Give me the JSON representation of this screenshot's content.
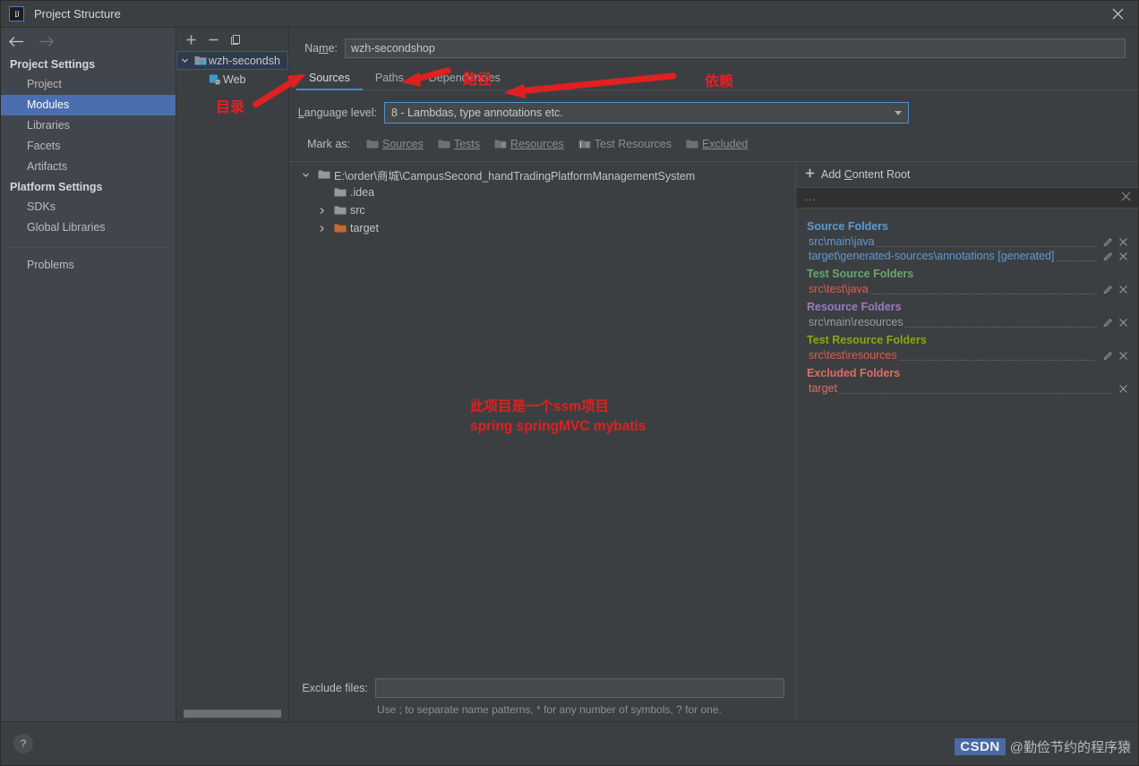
{
  "window": {
    "title": "Project Structure",
    "logo_text": "IJ",
    "close_icon": "close-icon"
  },
  "sidebar": {
    "back_icon": "arrow-left-icon",
    "forward_icon": "arrow-right-icon",
    "groups": [
      {
        "title": "Project Settings",
        "items": [
          {
            "label": "Project",
            "selected": false
          },
          {
            "label": "Modules",
            "selected": true
          },
          {
            "label": "Libraries",
            "selected": false
          },
          {
            "label": "Facets",
            "selected": false
          },
          {
            "label": "Artifacts",
            "selected": false
          }
        ]
      },
      {
        "title": "Platform Settings",
        "items": [
          {
            "label": "SDKs",
            "selected": false
          },
          {
            "label": "Global Libraries",
            "selected": false
          }
        ]
      }
    ],
    "problems_label": "Problems"
  },
  "modules_panel": {
    "toolbar": {
      "add_icon": "plus-icon",
      "remove_icon": "minus-icon",
      "copy_icon": "copy-icon"
    },
    "tree": [
      {
        "label": "wzh-secondsh",
        "icon": "module-icon",
        "expanded": true,
        "selected": true,
        "depth": 0
      },
      {
        "label": "Web",
        "icon": "web-facet-icon",
        "expanded": false,
        "selected": false,
        "depth": 1
      }
    ]
  },
  "module_editor": {
    "name_label": "Name:",
    "name_value": "wzh-secondshop",
    "tabs": [
      {
        "label": "Sources",
        "active": true
      },
      {
        "label": "Paths",
        "active": false
      },
      {
        "label": "Dependencies",
        "active": false
      }
    ],
    "language_level_label": "Language level:",
    "language_level_value": "8 - Lambdas, type annotations etc.",
    "mark_as_label": "Mark as:",
    "mark_as_buttons": [
      {
        "label": "Sources",
        "icon": "folder-sources-icon"
      },
      {
        "label": "Tests",
        "icon": "folder-tests-icon"
      },
      {
        "label": "Resources",
        "icon": "folder-resources-icon"
      },
      {
        "label": "Test Resources",
        "icon": "folder-test-resources-icon"
      },
      {
        "label": "Excluded",
        "icon": "folder-excluded-icon"
      }
    ],
    "content_tree": [
      {
        "label": "E:\\order\\商城\\CampusSecond_handTradingPlatformManagementSystem",
        "icon": "folder-icon",
        "twisty": "expanded",
        "depth": 0
      },
      {
        "label": ".idea",
        "icon": "folder-icon",
        "twisty": "none",
        "depth": 1
      },
      {
        "label": "src",
        "icon": "folder-icon",
        "twisty": "collapsed",
        "depth": 1
      },
      {
        "label": "target",
        "icon": "folder-orange-icon",
        "twisty": "collapsed",
        "depth": 1
      }
    ],
    "exclude_files_label": "Exclude files:",
    "exclude_files_value": "",
    "exclude_files_hint": "Use ; to separate name patterns, * for any number of symbols, ? for one."
  },
  "content_roots": {
    "add_content_root_label": "Add Content Root",
    "add_icon": "plus-icon",
    "root_row_label": "...",
    "root_remove_icon": "close-icon",
    "groups": [
      {
        "title": "Source Folders",
        "title_color": "#5b9bd5",
        "item_color": "#5b9bd5",
        "items": [
          {
            "path": "src\\main\\java",
            "edit_icon": "pencil-icon",
            "remove_icon": "close-icon"
          },
          {
            "path": "target\\generated-sources\\annotations [generated]",
            "edit_icon": "pencil-icon",
            "remove_icon": "close-icon"
          }
        ]
      },
      {
        "title": "Test Source Folders",
        "title_color": "#66a86b",
        "item_color": "#e05b4d",
        "items": [
          {
            "path": "src\\test\\java",
            "edit_icon": "pencil-icon",
            "remove_icon": "close-icon"
          }
        ]
      },
      {
        "title": "Resource Folders",
        "title_color": "#9a7ac0",
        "item_color": "#9a9a9a",
        "items": [
          {
            "path": "src\\main\\resources",
            "edit_icon": "pencil-icon",
            "remove_icon": "close-icon"
          }
        ]
      },
      {
        "title": "Test Resource Folders",
        "title_color": "#8aa80a",
        "item_color": "#e05b4d",
        "items": [
          {
            "path": "src\\test\\resources",
            "edit_icon": "pencil-icon",
            "remove_icon": "close-icon"
          }
        ]
      },
      {
        "title": "Excluded Folders",
        "title_color": "#e06c64",
        "item_color": "#e06c64",
        "items": [
          {
            "path": "target",
            "edit_icon": "",
            "remove_icon": "close-icon"
          }
        ]
      }
    ]
  },
  "footer": {
    "help_label": "?"
  },
  "annotations": {
    "color": "#ee1c24",
    "directory_label": "目录",
    "path_label": "路径",
    "dependency_label": "依赖",
    "note_line1": "此项目是一个ssm项目",
    "note_line2": "spring springMVC mybatis"
  },
  "watermark": {
    "brand": "CSDN",
    "user": "@勤俭节约的程序猿"
  }
}
